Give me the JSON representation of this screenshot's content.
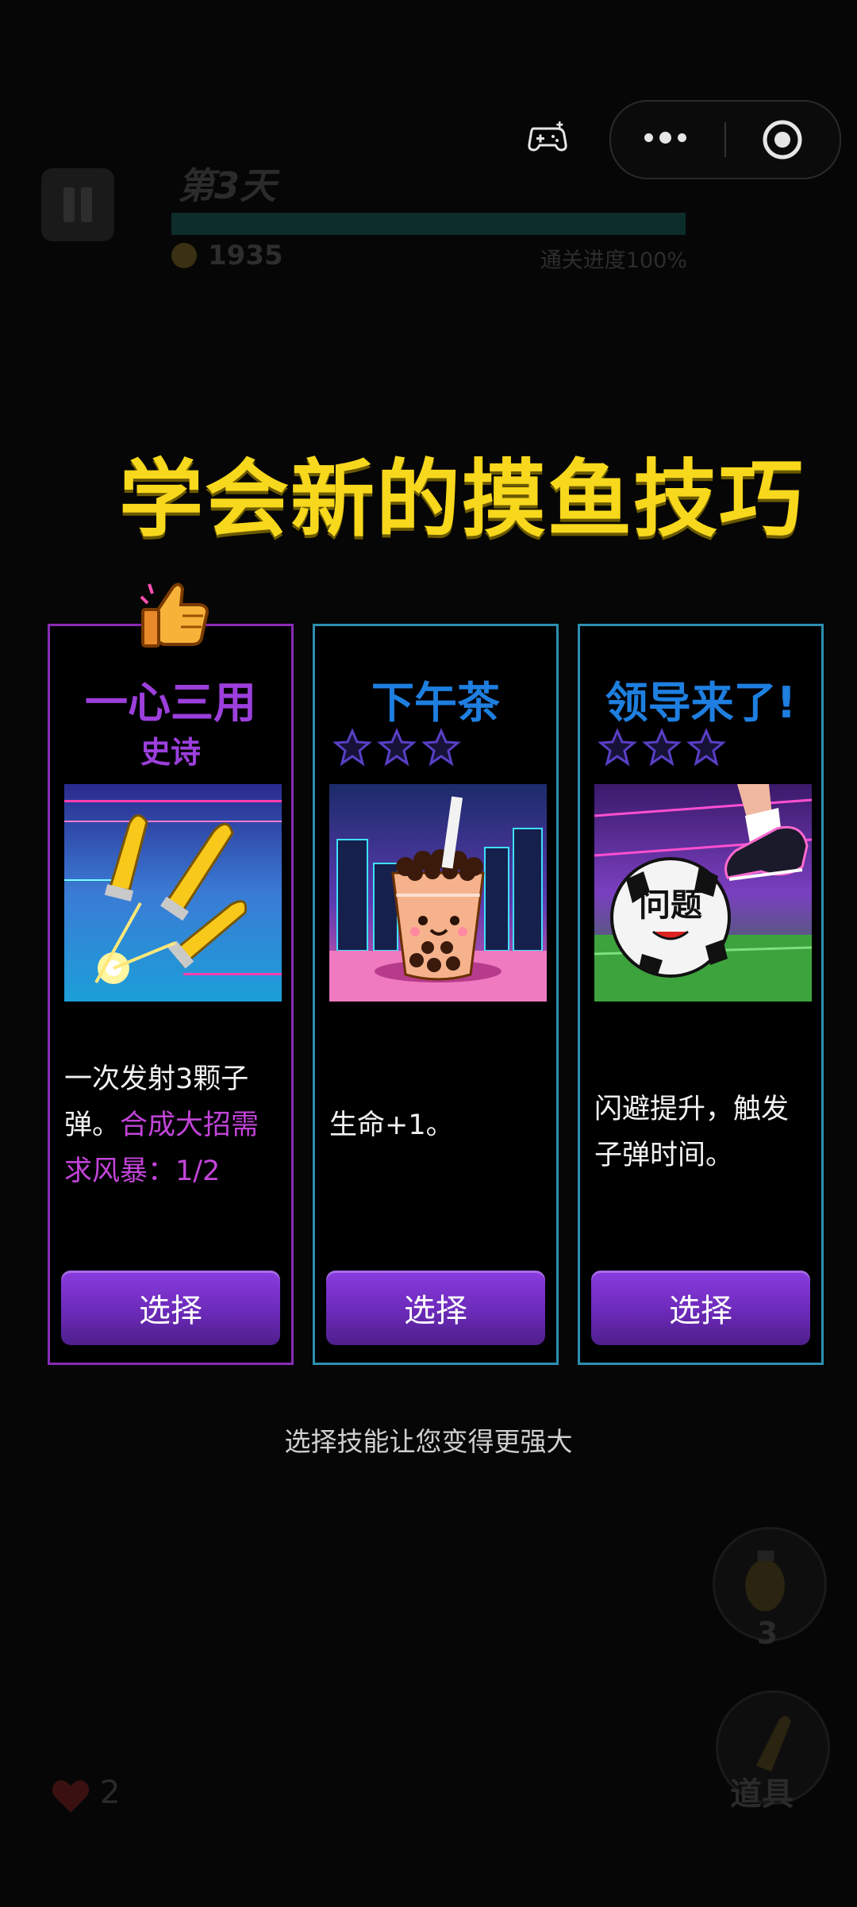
{
  "hud": {
    "day_title": "第3天",
    "coins": "1935",
    "progress_text": "通关进度100%",
    "progress_fraction": 1.0
  },
  "heading": "学会新的摸鱼技巧",
  "cards": [
    {
      "name": "一心三用",
      "rarity": "史诗",
      "desc_plain": "一次发射3颗子弹。",
      "desc_highlight": "合成大招需求风暴：1/2",
      "select_label": "选择"
    },
    {
      "name": "下午茶",
      "stars": 3,
      "desc_plain": "生命+1。",
      "select_label": "选择"
    },
    {
      "name": "领导来了!",
      "stars": 3,
      "desc_plain": "闪避提升，触发子弹时间。",
      "art_text": "问题",
      "select_label": "选择"
    }
  ],
  "hint": "选择技能让您变得更强大",
  "bottom": {
    "grenade_count": "3",
    "item_label": "道具",
    "lives": "2"
  },
  "icons": {
    "pause": "pause-icon",
    "game": "gamepad-icon",
    "more": "more-dots-icon",
    "close": "target-icon",
    "thumb": "thumbs-up-icon",
    "star": "star-outline-icon",
    "heart": "heart-icon",
    "grenade": "grenade-icon",
    "item": "bullet-icon",
    "coin": "coin-icon"
  },
  "colors": {
    "heading": "#f7d81c",
    "epic": "#9c3fdc",
    "common_title": "#1e7fe0",
    "button": "#7a35cc"
  }
}
